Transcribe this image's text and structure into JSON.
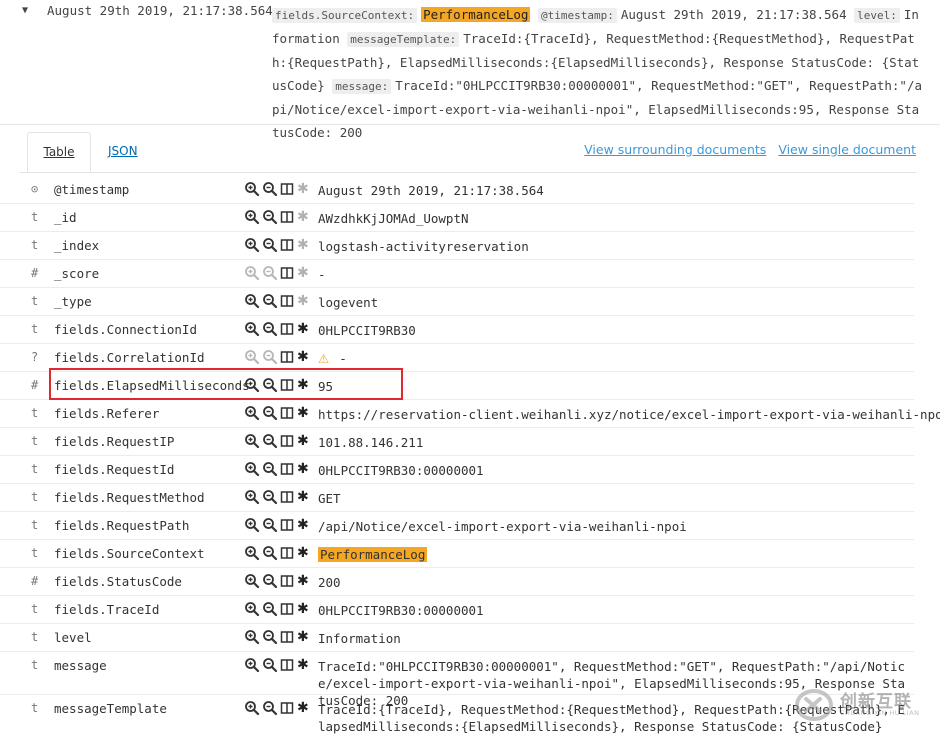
{
  "summary": {
    "timestamp": "August 29th 2019, 21:17:38.564",
    "source_context_label": "fields.SourceContext:",
    "source_context_value": "PerformanceLog",
    "timestamp_label": "@timestamp:",
    "timestamp_value": "August 29th 2019, 21:17:38.564",
    "level_label": "level:",
    "level_value": "Information",
    "message_template_label": "messageTemplate:",
    "message_template_value": "TraceId:{TraceId}, RequestMethod:{RequestMethod}, RequestPath:{RequestPath}, ElapsedMilliseconds:{ElapsedMilliseconds}, Response StatusCode: {StatusCode}",
    "message_label": "message:",
    "message_value": "TraceId:\"0HLPCCIT9RB30:00000001\", RequestMethod:\"GET\", RequestPath:\"/api/Notice/excel-import-export-via-weihanli-npoi\", ElapsedMilliseconds:95, Response StatusCode: 200"
  },
  "tabs": {
    "table": "Table",
    "json": "JSON"
  },
  "links": {
    "surrounding": "View surrounding documents",
    "single": "View single document"
  },
  "rows": [
    {
      "type": "⊙",
      "field": "@timestamp",
      "value": "August 29th 2019, 21:17:38.564",
      "dim_filters": false,
      "dim_exists": true
    },
    {
      "type": "t",
      "field": "_id",
      "value": "AWzdhkKjJOMAd_UowptN",
      "dim_filters": false,
      "dim_exists": true
    },
    {
      "type": "t",
      "field": "_index",
      "value": "logstash-activityreservation",
      "dim_filters": false,
      "dim_exists": true
    },
    {
      "type": "#",
      "field": "_score",
      "value": " -",
      "dim_filters": true,
      "dim_exists": true
    },
    {
      "type": "t",
      "field": "_type",
      "value": "logevent",
      "dim_filters": false,
      "dim_exists": true
    },
    {
      "type": "t",
      "field": "fields.ConnectionId",
      "value": "0HLPCCIT9RB30",
      "dim_filters": false,
      "dim_exists": false
    },
    {
      "type": "?",
      "field": "fields.CorrelationId",
      "value": "-",
      "dim_filters": true,
      "dim_exists": false,
      "warning": true
    },
    {
      "type": "#",
      "field": "fields.ElapsedMilliseconds",
      "value": "95",
      "dim_filters": false,
      "dim_exists": false
    },
    {
      "type": "t",
      "field": "fields.Referer",
      "value": "https://reservation-client.weihanli.xyz/notice/excel-import-export-via-weihanli-npoi",
      "dim_filters": false,
      "dim_exists": false
    },
    {
      "type": "t",
      "field": "fields.RequestIP",
      "value": "101.88.146.211",
      "dim_filters": false,
      "dim_exists": false
    },
    {
      "type": "t",
      "field": "fields.RequestId",
      "value": "0HLPCCIT9RB30:00000001",
      "dim_filters": false,
      "dim_exists": false
    },
    {
      "type": "t",
      "field": "fields.RequestMethod",
      "value": "GET",
      "dim_filters": false,
      "dim_exists": false
    },
    {
      "type": "t",
      "field": "fields.RequestPath",
      "value": "/api/Notice/excel-import-export-via-weihanli-npoi",
      "dim_filters": false,
      "dim_exists": false
    },
    {
      "type": "t",
      "field": "fields.SourceContext",
      "value": "PerformanceLog",
      "dim_filters": false,
      "dim_exists": false,
      "highlight": true
    },
    {
      "type": "#",
      "field": "fields.StatusCode",
      "value": "200",
      "dim_filters": false,
      "dim_exists": false
    },
    {
      "type": "t",
      "field": "fields.TraceId",
      "value": "0HLPCCIT9RB30:00000001",
      "dim_filters": false,
      "dim_exists": false
    },
    {
      "type": "t",
      "field": "level",
      "value": "Information",
      "dim_filters": false,
      "dim_exists": false
    },
    {
      "type": "t",
      "field": "message",
      "value": "TraceId:\"0HLPCCIT9RB30:00000001\", RequestMethod:\"GET\", RequestPath:\"/api/Notice/excel-import-export-via-weihanli-npoi\", ElapsedMilliseconds:95, Response StatusCode: 200",
      "dim_filters": false,
      "dim_exists": false,
      "tall": true
    },
    {
      "type": "t",
      "field": "messageTemplate",
      "value": "TraceId:{TraceId}, RequestMethod:{RequestMethod}, RequestPath:{RequestPath}, ElapsedMilliseconds:{ElapsedMilliseconds}, Response StatusCode: {StatusCode}",
      "dim_filters": false,
      "dim_exists": false,
      "tall": true
    }
  ],
  "watermark": {
    "text": "创新互联",
    "sub": "CHUANG XIN HU LIAN"
  },
  "colors": {
    "highlight": "#f5a623",
    "link": "#3a9ad9",
    "red_box": "#e0282e"
  }
}
